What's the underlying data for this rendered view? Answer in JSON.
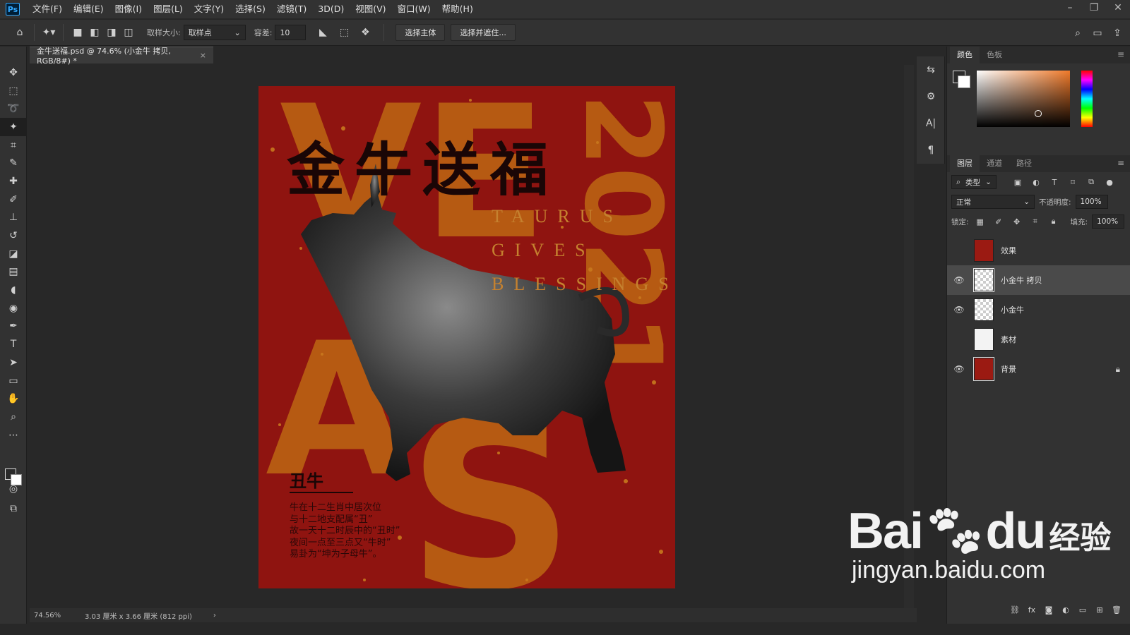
{
  "app": {
    "logo": "Ps",
    "menu": [
      "文件(F)",
      "编辑(E)",
      "图像(I)",
      "图层(L)",
      "文字(Y)",
      "选择(S)",
      "滤镜(T)",
      "3D(D)",
      "视图(V)",
      "窗口(W)",
      "帮助(H)"
    ],
    "window_controls": {
      "minimize": "–",
      "restore": "❐",
      "close": "✕"
    }
  },
  "options_bar": {
    "sample_size_label": "取样大小:",
    "sample_size_value": "取样点",
    "tolerance_label": "容差:",
    "tolerance_value": "10",
    "select_subject_label": "选择主体",
    "select_mask_label": "选择并遮住..."
  },
  "document": {
    "tab_title": "金牛送福.psd @ 74.6% (小金牛 拷贝, RGB/8#) *",
    "tab_close": "×"
  },
  "poster": {
    "bg_letters": [
      "VE",
      "A",
      "S",
      "2021"
    ],
    "title": "金牛送福",
    "english_lines": [
      "TAURUS",
      "GIVES",
      "BLESSINGS"
    ],
    "subtitle": "丑牛",
    "description": [
      "牛在十二生肖中居次位",
      "与十二地支配属“丑”",
      "故一天十二时辰中的“丑时”",
      "夜间一点至三点又“牛时”",
      "易卦为“坤为子母牛”。"
    ]
  },
  "status": {
    "zoom": "74.56%",
    "doc_size": "3.03 厘米 x 3.66 厘米 (812 ppi)",
    "arrow": "›"
  },
  "color_panel": {
    "tabs": [
      "颜色",
      "色板"
    ]
  },
  "layers_panel": {
    "tabs": [
      "图层",
      "通道",
      "路径"
    ],
    "filter_kind": "类型",
    "blend_mode": "正常",
    "opacity_label": "不透明度:",
    "opacity_value": "100%",
    "lock_label": "锁定:",
    "fill_label": "填充:",
    "fill_value": "100%",
    "layers": [
      {
        "name": "效果",
        "visible": false,
        "selected": false,
        "thumb": "red",
        "locked": false
      },
      {
        "name": "小金牛 拷贝",
        "visible": true,
        "selected": true,
        "thumb": "checker",
        "locked": false
      },
      {
        "name": "小金牛",
        "visible": true,
        "selected": false,
        "thumb": "checker",
        "locked": false
      },
      {
        "name": "素材",
        "visible": false,
        "selected": false,
        "thumb": "white",
        "locked": false
      },
      {
        "name": "背景",
        "visible": true,
        "selected": false,
        "thumb": "red-sel",
        "locked": true
      }
    ]
  },
  "watermark": {
    "brand": "Bai",
    "brand_tail": "du",
    "chinese": "经验",
    "url": "jingyan.baidu.com"
  },
  "colors": {
    "poster_red": "#8f1410",
    "poster_orange": "#b65a12",
    "ps_blue": "#31a8ff"
  }
}
